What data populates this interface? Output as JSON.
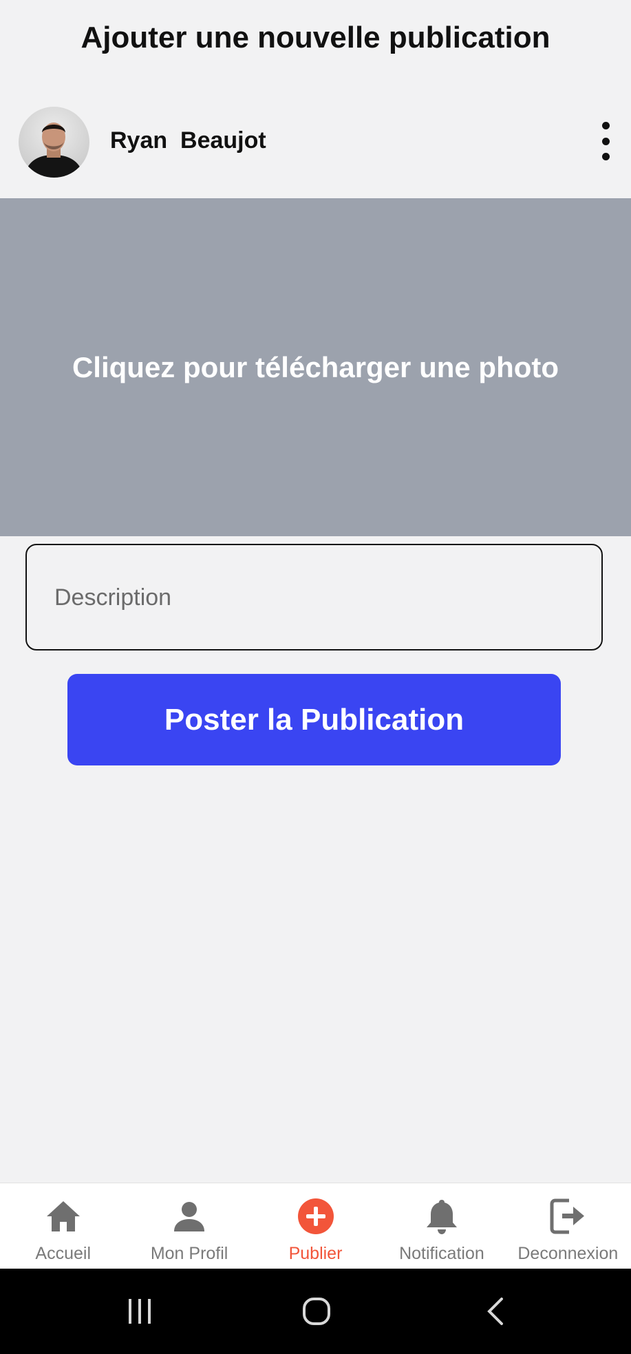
{
  "header": {
    "title": "Ajouter une nouvelle publication"
  },
  "author": {
    "name": "Ryan  Beaujot",
    "avatar_alt": "profile photo",
    "more_icon": "more-vertical-icon"
  },
  "upload": {
    "label": "Cliquez pour télécharger une photo"
  },
  "form": {
    "description_placeholder": "Description",
    "description_value": "",
    "submit_label": "Poster la Publication"
  },
  "bottom_nav": {
    "items": [
      {
        "label": "Accueil",
        "icon": "home-icon",
        "active": false
      },
      {
        "label": "Mon Profil",
        "icon": "person-icon",
        "active": false
      },
      {
        "label": "Publier",
        "icon": "add-circle-icon",
        "active": true
      },
      {
        "label": "Notification",
        "icon": "bell-icon",
        "active": false
      },
      {
        "label": "Deconnexion",
        "icon": "logout-icon",
        "active": false
      }
    ]
  },
  "system_nav": {
    "recents": "recents-icon",
    "home": "home-circle-icon",
    "back": "back-chevron-icon"
  },
  "colors": {
    "accent": "#3a45f2",
    "active_tab": "#f2553a",
    "upload_bg": "#9ca2ad",
    "page_bg": "#f2f2f3"
  }
}
